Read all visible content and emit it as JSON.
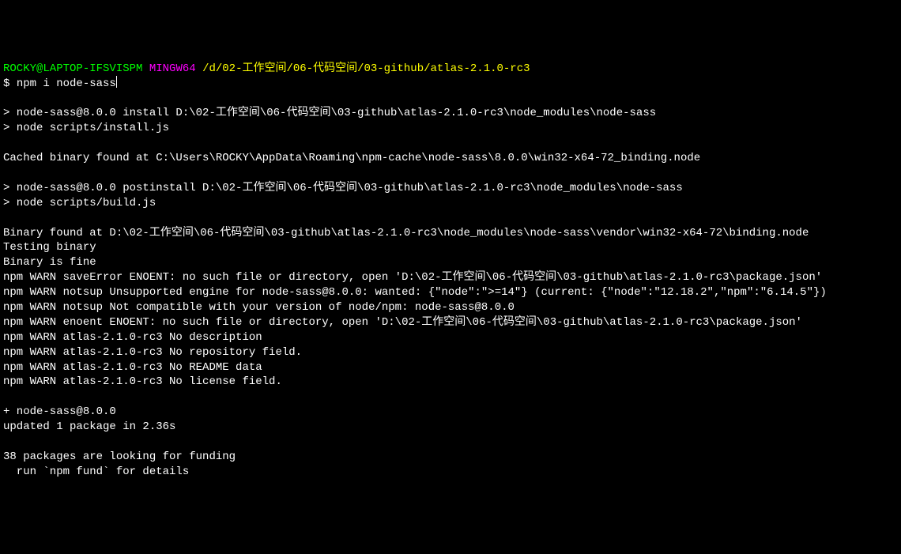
{
  "prompt": {
    "user_host": "ROCKY@LAPTOP-IFSVISPM",
    "env": "MINGW64",
    "path": "/d/02-工作空间/06-代码空间/03-github/atlas-2.1.0-rc3",
    "symbol": "$",
    "command": "npm i node-sass"
  },
  "output": {
    "l1": "",
    "l2": "> node-sass@8.0.0 install D:\\02-工作空间\\06-代码空间\\03-github\\atlas-2.1.0-rc3\\node_modules\\node-sass",
    "l3": "> node scripts/install.js",
    "l4": "",
    "l5": "Cached binary found at C:\\Users\\ROCKY\\AppData\\Roaming\\npm-cache\\node-sass\\8.0.0\\win32-x64-72_binding.node",
    "l6": "",
    "l7": "> node-sass@8.0.0 postinstall D:\\02-工作空间\\06-代码空间\\03-github\\atlas-2.1.0-rc3\\node_modules\\node-sass",
    "l8": "> node scripts/build.js",
    "l9": "",
    "l10": "Binary found at D:\\02-工作空间\\06-代码空间\\03-github\\atlas-2.1.0-rc3\\node_modules\\node-sass\\vendor\\win32-x64-72\\binding.node",
    "l11": "Testing binary",
    "l12": "Binary is fine",
    "l13": "npm WARN saveError ENOENT: no such file or directory, open 'D:\\02-工作空间\\06-代码空间\\03-github\\atlas-2.1.0-rc3\\package.json'",
    "l14": "npm WARN notsup Unsupported engine for node-sass@8.0.0: wanted: {\"node\":\">=14\"} (current: {\"node\":\"12.18.2\",\"npm\":\"6.14.5\"})",
    "l15": "npm WARN notsup Not compatible with your version of node/npm: node-sass@8.0.0",
    "l16": "npm WARN enoent ENOENT: no such file or directory, open 'D:\\02-工作空间\\06-代码空间\\03-github\\atlas-2.1.0-rc3\\package.json'",
    "l17": "npm WARN atlas-2.1.0-rc3 No description",
    "l18": "npm WARN atlas-2.1.0-rc3 No repository field.",
    "l19": "npm WARN atlas-2.1.0-rc3 No README data",
    "l20": "npm WARN atlas-2.1.0-rc3 No license field.",
    "l21": "",
    "l22": "+ node-sass@8.0.0",
    "l23": "updated 1 package in 2.36s",
    "l24": "",
    "l25": "38 packages are looking for funding",
    "l26": "  run `npm fund` for details"
  }
}
